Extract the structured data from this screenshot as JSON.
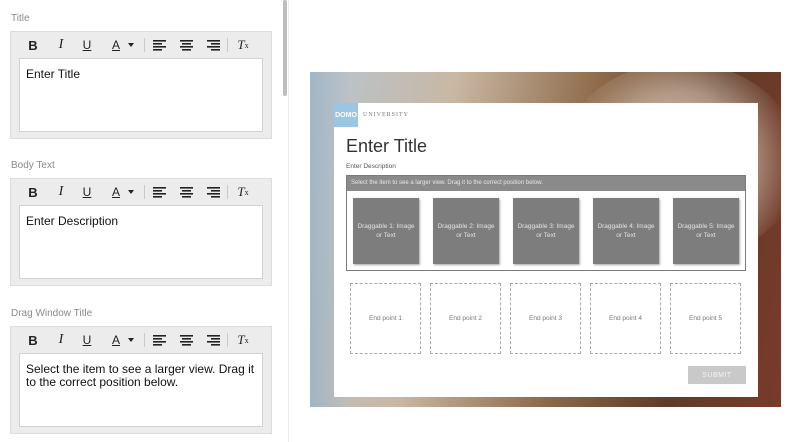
{
  "fields": [
    {
      "label": "Title",
      "content": "Enter Title"
    },
    {
      "label": "Body Text",
      "content": "Enter Description"
    },
    {
      "label": "Drag Window Title",
      "content": "Select the item to see a larger view. Drag it to the correct position below."
    }
  ],
  "toolbar": {
    "bold": "B",
    "italic": "I",
    "underline": "U",
    "text_color": "A",
    "clear_format": "T",
    "clear_sub": "x"
  },
  "preview": {
    "logo_mark": "DOMO",
    "logo_text": "UNIVERSITY",
    "title": "Enter Title",
    "description": "Enter Description",
    "drag_window_title": "Select the item to see a larger view. Drag it to the correct position below.",
    "draggables": [
      "Draggable 1: Image or Text",
      "Draggable 2: Image or Text",
      "Draggable 3: Image or Text",
      "Draggable 4: Image or Text",
      "Draggable 5: Image or Text"
    ],
    "endpoints": [
      "End point 1",
      "End point 2",
      "End point 3",
      "End point 4",
      "End point 5"
    ],
    "submit_label": "SUBMIT"
  },
  "colors": {
    "logo_blue": "#99c6e4",
    "draggable_gray": "#7d7d7d",
    "submit_gray": "#c9c9c9"
  }
}
